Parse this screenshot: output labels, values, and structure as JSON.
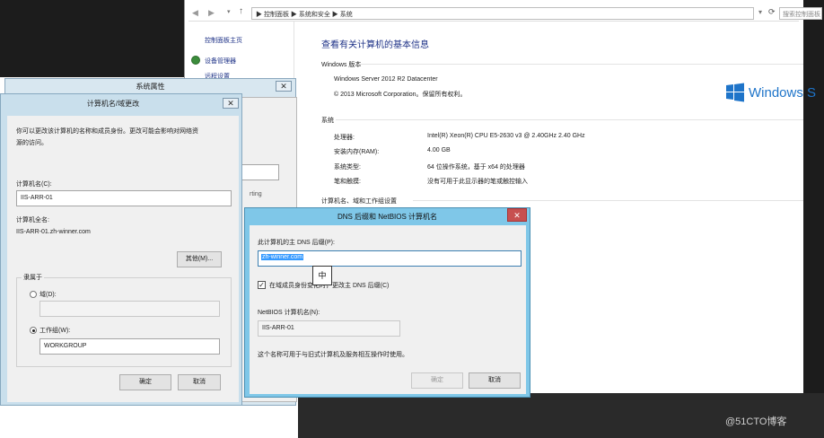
{
  "system_window": {
    "address_path": "▶ 控制面板 ▶ 系统和安全 ▶ 系统",
    "search_placeholder": "搜索控制面板",
    "sidebar": {
      "home_label": "控制面板主页",
      "items": [
        "设备管理器",
        "远程设置"
      ]
    },
    "main_title": "查看有关计算机的基本信息",
    "edition_section": "Windows 版本",
    "edition_name": "Windows Server 2012 R2 Datacenter",
    "copyright": "© 2013 Microsoft Corporation。保留所有权利。",
    "logo_text": "Windows S",
    "system_section": "系统",
    "specs": [
      {
        "label": "处理器:",
        "value": "Intel(R) Xeon(R) CPU E5-2630 v3 @ 2.40GHz   2.40 GHz"
      },
      {
        "label": "安装内存(RAM):",
        "value": "4.00 GB"
      },
      {
        "label": "系统类型:",
        "value": "64 位操作系统，基于 x64 的处理器"
      },
      {
        "label": "笔和触摸:",
        "value": "没有可用于此显示器的笔或触控输入"
      }
    ],
    "domain_section": "计算机名、域和工作组设置",
    "partial_text": "rting"
  },
  "system_props": {
    "title": "系统属性",
    "close_glyph": "✕"
  },
  "name_dialog": {
    "title": "计算机名/域更改",
    "close_glyph": "✕",
    "description_line1": "你可以更改该计算机的名称和成员身份。更改可能会影响对网络资",
    "description_line2": "源的访问。",
    "computer_name_label": "计算机名(C):",
    "computer_name_value": "IIS-ARR-01",
    "full_name_label": "计算机全名:",
    "full_name_value": "IIS-ARR-01.zh-winner.com",
    "other_button": "其他(M)...",
    "member_of_label": "隶属于",
    "domain_radio_label": "域(D):",
    "domain_value": "",
    "workgroup_radio_label": "工作组(W):",
    "workgroup_value": "WORKGROUP",
    "ok_button": "确定",
    "cancel_button": "取消"
  },
  "dns_dialog": {
    "title": "DNS 后缀和 NetBIOS 计算机名",
    "close_glyph": "✕",
    "suffix_label": "此计算机的主 DNS 后缀(P):",
    "suffix_value": "zh-winner.com",
    "checkbox_label": "在域成员身份变化时，更改主 DNS 后缀(C)",
    "checkbox_checked": true,
    "netbios_label": "NetBIOS 计算机名(N):",
    "netbios_value": "IIS-ARR-01",
    "interop_note": "这个名称可用于与旧式计算机及服务相互操作时使用。",
    "ok_button": "确定",
    "cancel_button": "取消",
    "ime_indicator": "中"
  },
  "watermark": "@51CTO博客",
  "colors": {
    "accent_title": "#1e3287",
    "windows_blue": "#1e74c9",
    "dns_frame": "#7fc7e8",
    "close_red": "#c75050",
    "selection": "#3399ff"
  }
}
